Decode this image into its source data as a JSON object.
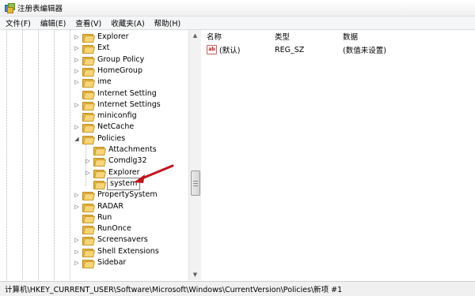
{
  "window": {
    "title": "注册表编辑器"
  },
  "menu": [
    "文件(F)",
    "编辑(E)",
    "查看(V)",
    "收藏夹(A)",
    "帮助(H)"
  ],
  "tree": {
    "items": [
      {
        "label": "Explorer",
        "expander": "▷",
        "level": 1
      },
      {
        "label": "Ext",
        "expander": "▷",
        "level": 1
      },
      {
        "label": "Group Policy",
        "expander": "▷",
        "level": 1
      },
      {
        "label": "HomeGroup",
        "expander": "▷",
        "level": 1
      },
      {
        "label": "ime",
        "expander": "▷",
        "level": 1
      },
      {
        "label": "Internet Setting",
        "expander": "",
        "level": 1
      },
      {
        "label": "Internet Settings",
        "expander": "▷",
        "level": 1
      },
      {
        "label": "miniconfig",
        "expander": "",
        "level": 1
      },
      {
        "label": "NetCache",
        "expander": "▷",
        "level": 1
      },
      {
        "label": "Policies",
        "expander": "◢",
        "level": 1
      },
      {
        "label": "Attachments",
        "expander": "",
        "level": 2
      },
      {
        "label": "Comdlg32",
        "expander": "▷",
        "level": 2
      },
      {
        "label": "Explorer",
        "expander": "▷",
        "level": 2
      },
      {
        "label": "system",
        "expander": "",
        "level": 2,
        "selected": true
      },
      {
        "label": "PropertySystem",
        "expander": "▷",
        "level": 1
      },
      {
        "label": "RADAR",
        "expander": "▷",
        "level": 1
      },
      {
        "label": "Run",
        "expander": "",
        "level": 1
      },
      {
        "label": "RunOnce",
        "expander": "",
        "level": 1
      },
      {
        "label": "Screensavers",
        "expander": "▷",
        "level": 1
      },
      {
        "label": "Shell Extensions",
        "expander": "▷",
        "level": 1
      },
      {
        "label": "Sidebar",
        "expander": "▷",
        "level": 1
      }
    ]
  },
  "values": {
    "headers": {
      "name": "名称",
      "type": "类型",
      "data": "数据"
    },
    "rows": [
      {
        "icon": "string-value-icon",
        "icon_text": "ab",
        "name": "(默认)",
        "type": "REG_SZ",
        "data": "(数值未设置)"
      }
    ]
  },
  "annotation": {
    "color": "#c0141c"
  },
  "status": {
    "path": "计算机\\HKEY_CURRENT_USER\\Software\\Microsoft\\Windows\\CurrentVersion\\Policies\\新项 #1"
  }
}
